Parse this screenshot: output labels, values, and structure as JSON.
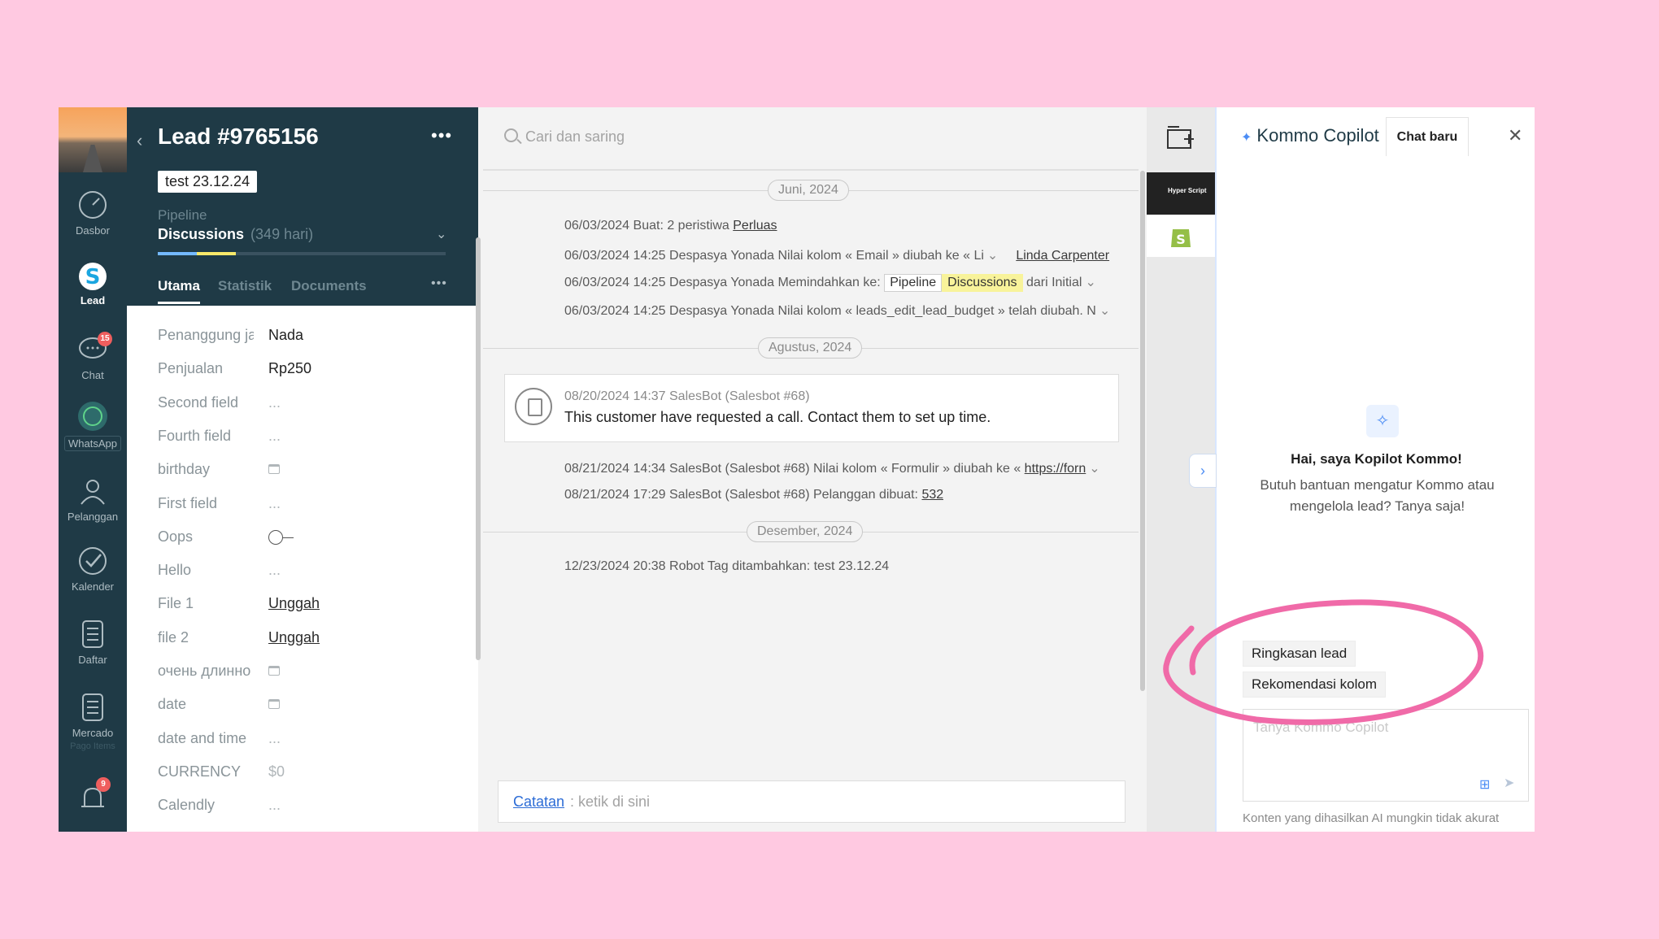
{
  "nav": {
    "items": [
      {
        "label": "Dasbor",
        "icon": "gauge-icon"
      },
      {
        "label": "Lead",
        "icon": "lead-s-icon"
      },
      {
        "label": "Chat",
        "icon": "chat-icon",
        "badge": "15"
      },
      {
        "label": "WhatsApp",
        "icon": "whatsapp-icon"
      },
      {
        "label": "Pelanggan",
        "icon": "contacts-icon"
      },
      {
        "label": "Kalender",
        "icon": "check-circle-icon"
      },
      {
        "label": "Daftar",
        "icon": "list-icon"
      },
      {
        "label": "Mercado",
        "icon": "list-icon"
      },
      {
        "label": "Pago Items",
        "icon": ""
      }
    ],
    "bell_badge": "9"
  },
  "lead": {
    "title": "Lead #9765156",
    "tag": "test 23.12.24",
    "pipeline_label": "Pipeline",
    "stage": "Discussions",
    "stage_days": "(349 hari)",
    "tabs": [
      "Utama",
      "Statistik",
      "Documents"
    ],
    "fields": [
      {
        "label": "Penanggung jawab",
        "value": "Nada",
        "kind": "text"
      },
      {
        "label": "Penjualan",
        "value": "Rp250",
        "kind": "text"
      },
      {
        "label": "Second field",
        "value": "...",
        "kind": "muted"
      },
      {
        "label": "Fourth field",
        "value": "...",
        "kind": "muted"
      },
      {
        "label": "birthday",
        "value": "",
        "kind": "calendar"
      },
      {
        "label": "First field",
        "value": "...",
        "kind": "muted"
      },
      {
        "label": "Oops",
        "value": "",
        "kind": "toggle"
      },
      {
        "label": "Hello",
        "value": "...",
        "kind": "muted"
      },
      {
        "label": "File 1",
        "value": "Unggah",
        "kind": "link"
      },
      {
        "label": "file 2",
        "value": "Unggah",
        "kind": "link"
      },
      {
        "label": "очень длинно",
        "value": "",
        "kind": "calendar"
      },
      {
        "label": "date",
        "value": "",
        "kind": "calendar"
      },
      {
        "label": "date and time",
        "value": "...",
        "kind": "muted"
      },
      {
        "label": "CURRENCY",
        "value": "$0",
        "kind": "muted"
      },
      {
        "label": "Calendly",
        "value": "...",
        "kind": "muted"
      }
    ]
  },
  "feed": {
    "search_placeholder": "Cari dan saring",
    "dates": [
      "Juni, 2024",
      "Agustus, 2024",
      "Desember, 2024"
    ],
    "events": [
      {
        "text": "06/03/2024 Buat: 2 peristiwa ",
        "link": "Perluas"
      },
      {
        "text": "06/03/2024 14:25 Despasya Yonada Nilai kolom « Email » diubah ke « Li",
        "user": "Linda Carpenter"
      },
      {
        "text": "06/03/2024 14:25 Despasya Yonada Memindahkan ke:",
        "chip1": "Pipeline",
        "chip2": "Discussions",
        "tail": "dari Initial"
      },
      {
        "text": "06/03/2024 14:25 Despasya Yonada Nilai kolom « leads_edit_lead_budget » telah diubah. N"
      },
      {
        "text": "08/21/2024 14:34 SalesBot (Salesbot #68) Nilai kolom « Formulir » diubah ke « ",
        "link": "https://forn"
      },
      {
        "text": "08/21/2024 17:29 SalesBot (Salesbot #68) Pelanggan dibuat: ",
        "link": "532"
      },
      {
        "text": "12/23/2024 20:38 Robot Tag ditambahkan: test 23.12.24"
      }
    ],
    "note_meta": "08/20/2024 14:37 SalesBot (Salesbot #68)",
    "note_text": "This customer have requested a call. Contact them to set up time.",
    "composer_link": "Catatan",
    "composer_placeholder": ": ketik di sini"
  },
  "strip": {
    "hyper_label": "Hyper Script"
  },
  "copilot": {
    "title": "Kommo Copilot",
    "new_chat": "Chat baru",
    "greeting": "Hai, saya Kopilot Kommo!",
    "subtitle": "Butuh bantuan mengatur Kommo atau mengelola lead? Tanya saja!",
    "chips": [
      "Ringkasan lead",
      "Rekomendasi kolom"
    ],
    "input_placeholder": "Tanya Kommo Copilot",
    "disclaimer": "Konten yang dihasilkan AI mungkin tidak akurat"
  },
  "colors": {
    "sidebar": "#1f3a46",
    "accent": "#4b8cf5",
    "annotation": "#f06aa8",
    "background": "#ffc9e1"
  }
}
